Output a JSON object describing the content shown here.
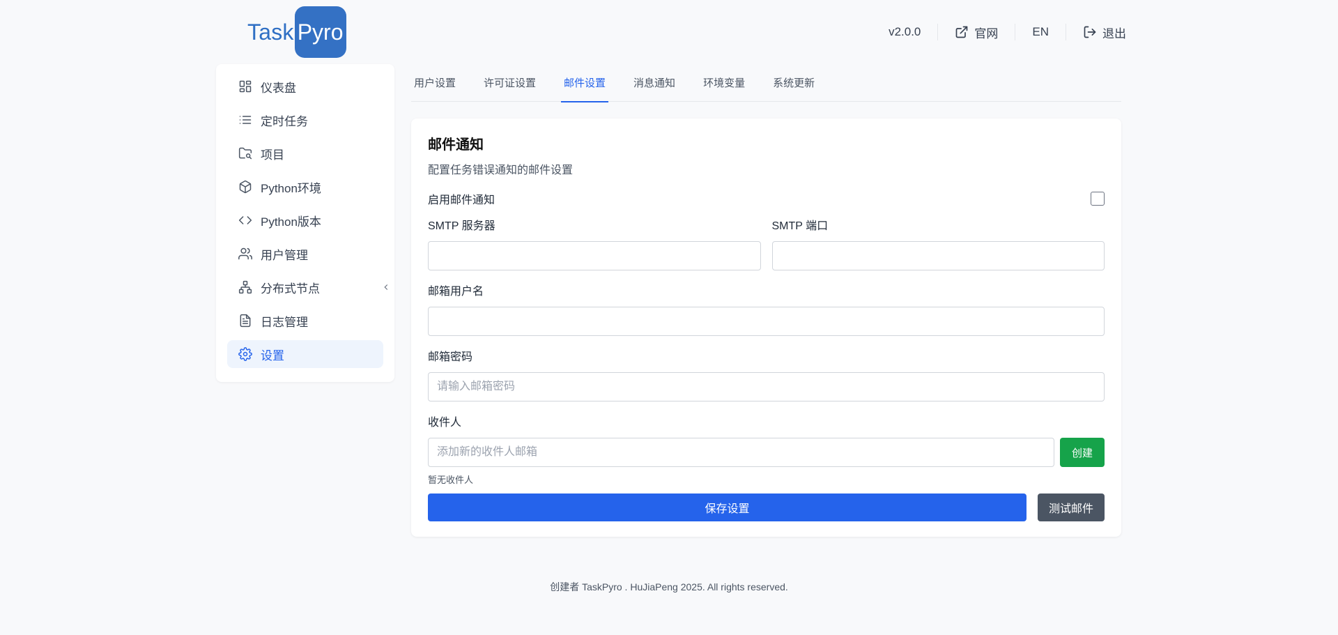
{
  "logo": {
    "part1": "Task",
    "part2": "Pyro"
  },
  "header": {
    "version": "v2.0.0",
    "website_label": "官网",
    "website_icon": "external-link-icon",
    "language": "EN",
    "logout_label": "退出",
    "logout_icon": "logout-icon"
  },
  "sidebar": {
    "items": [
      {
        "label": "仪表盘",
        "icon": "dashboard-icon"
      },
      {
        "label": "定时任务",
        "icon": "list-icon"
      },
      {
        "label": "项目",
        "icon": "folder-icon"
      },
      {
        "label": "Python环境",
        "icon": "box-icon"
      },
      {
        "label": "Python版本",
        "icon": "code-icon"
      },
      {
        "label": "用户管理",
        "icon": "users-icon"
      },
      {
        "label": "分布式节点",
        "icon": "network-icon"
      },
      {
        "label": "日志管理",
        "icon": "file-text-icon"
      },
      {
        "label": "设置",
        "icon": "gear-icon",
        "active": true
      }
    ],
    "collapse_icon": "chevron-left-icon"
  },
  "tabs": [
    {
      "label": "用户设置"
    },
    {
      "label": "许可证设置"
    },
    {
      "label": "邮件设置",
      "active": true
    },
    {
      "label": "消息通知"
    },
    {
      "label": "环境变量"
    },
    {
      "label": "系统更新"
    }
  ],
  "email": {
    "title": "邮件通知",
    "description": "配置任务错误通知的邮件设置",
    "enable_label": "启用邮件通知",
    "enabled": false,
    "smtp_server_label": "SMTP 服务器",
    "smtp_server_value": "",
    "smtp_port_label": "SMTP 端口",
    "smtp_port_value": "",
    "username_label": "邮箱用户名",
    "username_value": "",
    "password_label": "邮箱密码",
    "password_placeholder": "请输入邮箱密码",
    "recipients_label": "收件人",
    "recipient_placeholder": "添加新的收件人邮箱",
    "create_label": "创建",
    "empty_recipients": "暂无收件人",
    "save_label": "保存设置",
    "test_label": "测试邮件"
  },
  "footer": {
    "text": "创建者 TaskPyro . HuJiaPeng 2025. All rights reserved."
  },
  "colors": {
    "primary": "#2563eb",
    "success": "#16a34a",
    "secondary": "#4b5563",
    "logo": "#3471c4"
  }
}
